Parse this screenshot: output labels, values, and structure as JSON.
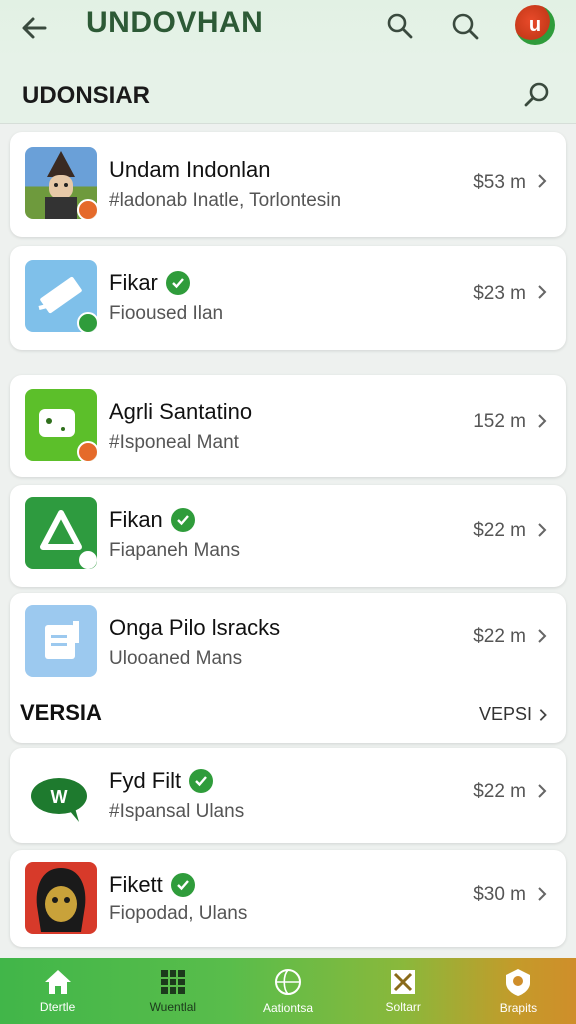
{
  "header": {
    "title": "UNDOVHAN",
    "avatar_text": "u"
  },
  "subheader": {
    "label": "UDONSIAR"
  },
  "items": [
    {
      "name": "Undam Indonlan",
      "sub": "#ladonab Inatle, Torlontesin",
      "price": "$53 m",
      "verified": false,
      "icon": "temple-figure-icon",
      "thumb_color": "#6aa0d8"
    },
    {
      "name": "Fikar",
      "sub": "Fiooused Ilan",
      "price": "$23 m",
      "verified": true,
      "icon": "ticket-icon",
      "thumb_color": "#7fc0ea"
    },
    {
      "name": "Agrli Santatino",
      "sub": "#Isponeal Mant",
      "price": "152 m",
      "verified": false,
      "icon": "chat-box-icon",
      "thumb_color": "#5cbf2a"
    },
    {
      "name": "Fikan",
      "sub": "Fiapaneh Mans",
      "price": "$22 m",
      "verified": true,
      "icon": "triangle-recycle-icon",
      "thumb_color": "#2e9b3f"
    },
    {
      "name": "Onga Pilo lsracks",
      "sub": "Ulooaned Mans",
      "price": "$22 m",
      "verified": false,
      "icon": "document-icon",
      "thumb_color": "#9cc9ef"
    },
    {
      "name": "Fyd Filt",
      "sub": "#Ispansal Ulans",
      "price": "$22 m",
      "verified": true,
      "icon": "whatsapp-bubble-icon",
      "thumb_color": "#ffffff"
    },
    {
      "name": "Fikett",
      "sub": "Fiopodad, Ulans",
      "price": "$30 m",
      "verified": true,
      "icon": "masked-figure-icon",
      "thumb_color": "#222222"
    }
  ],
  "section": {
    "label": "VERSIA",
    "link": "VEPSI"
  },
  "nav": [
    {
      "label": "Dtertle",
      "icon": "home-icon"
    },
    {
      "label": "Wuentlal",
      "icon": "grid-icon"
    },
    {
      "label": "Aationtsa",
      "icon": "globe-icon"
    },
    {
      "label": "Soltarr",
      "icon": "tools-icon"
    },
    {
      "label": "Brapits",
      "icon": "shield-icon"
    }
  ],
  "colors": {
    "accent": "#2f9c3b",
    "header_bg": "#e4f1e6"
  }
}
